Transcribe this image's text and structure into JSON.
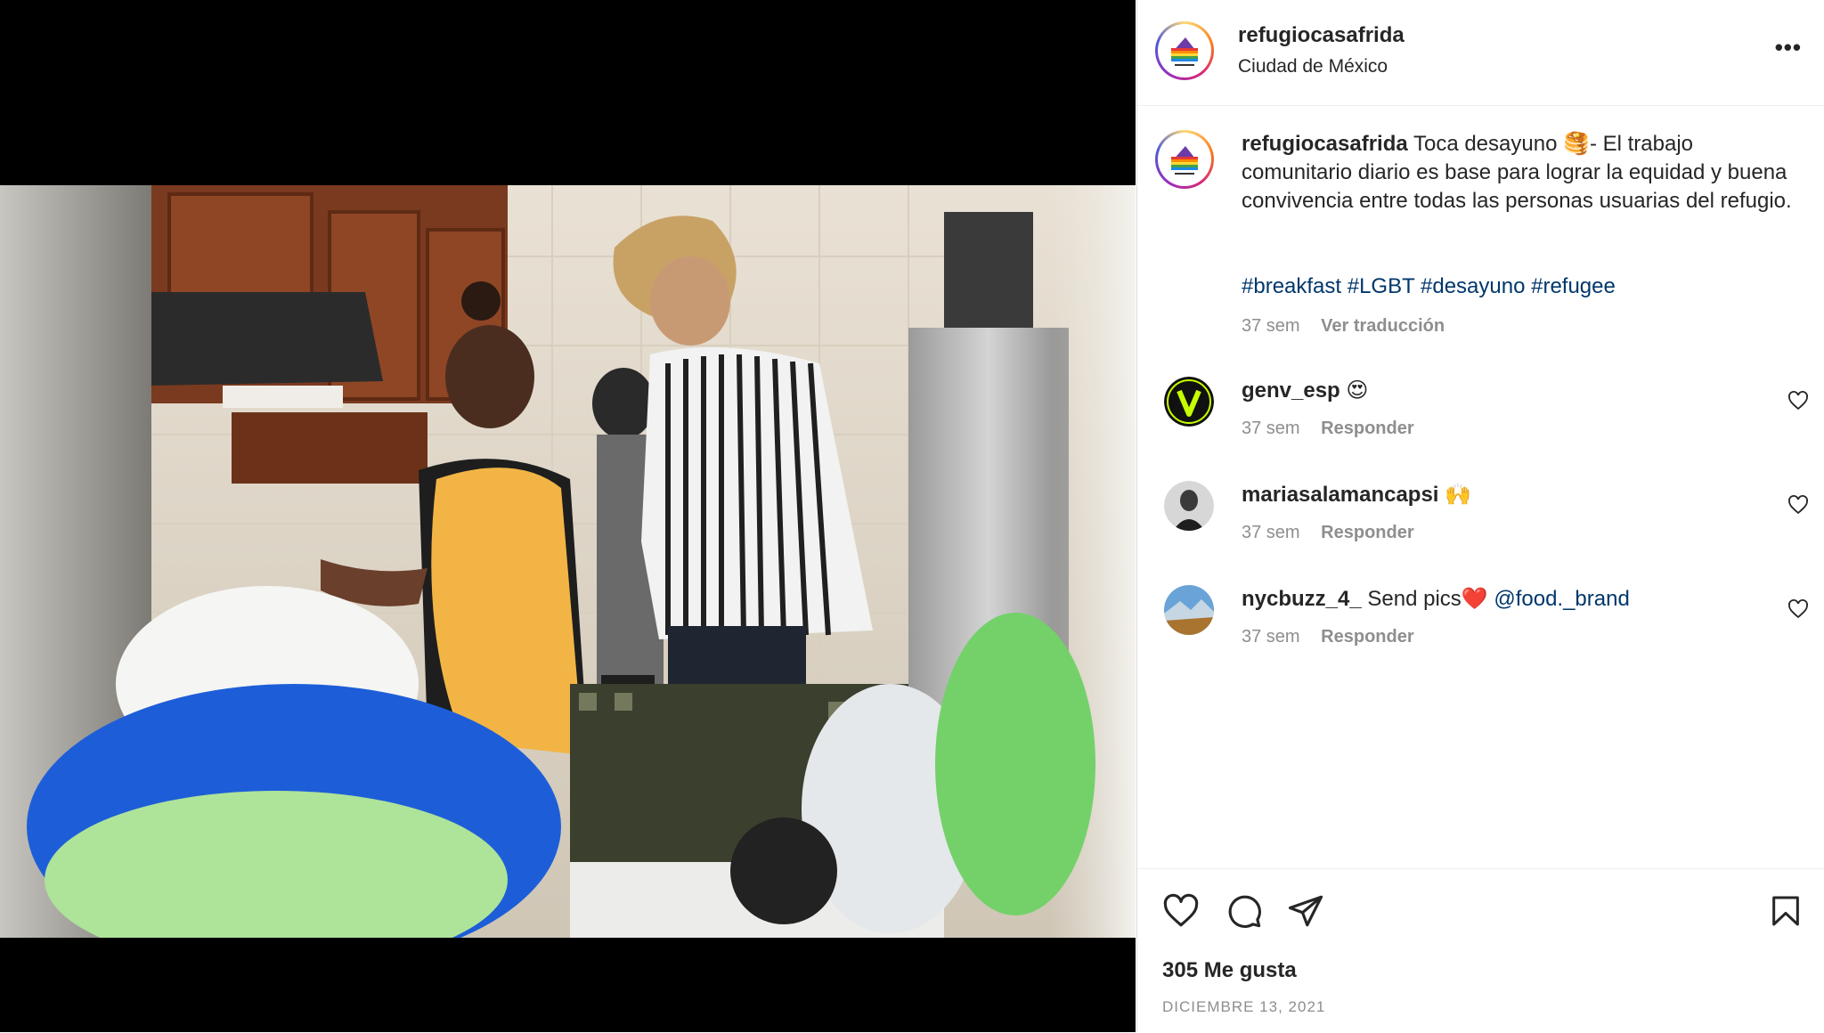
{
  "post": {
    "username": "refugiocasafrida",
    "location": "Ciudad de México",
    "more_label": "•••"
  },
  "caption": {
    "username": "refugiocasafrida",
    "text": "Toca desayuno 🥞- El trabajo comunitario diario es base para lograr la equidad y buena convivencia entre todas las personas usuarias del refugio.",
    "hashtags": "#breakfast #LGBT #desayuno #refugee",
    "time": "37 sem",
    "translate_label": "Ver traducción"
  },
  "comments": [
    {
      "username": "genv_esp",
      "text": "😍",
      "time": "37 sem",
      "reply_label": "Responder"
    },
    {
      "username": "mariasalamancapsi",
      "text": "🙌",
      "time": "37 sem",
      "reply_label": "Responder"
    },
    {
      "username": "nycbuzz_4_",
      "text": "Send pics❤️",
      "mention": "@food._brand",
      "time": "37 sem",
      "reply_label": "Responder"
    }
  ],
  "stats": {
    "likes": "305 Me gusta",
    "date": "DICIEMBRE 13, 2021"
  },
  "colors": {
    "link": "#00376b",
    "muted": "#8e8e8e",
    "text": "#262626"
  },
  "icons": {
    "like": "heart-icon",
    "comment": "comment-icon",
    "share": "send-icon",
    "save": "bookmark-icon",
    "more": "more-icon"
  }
}
